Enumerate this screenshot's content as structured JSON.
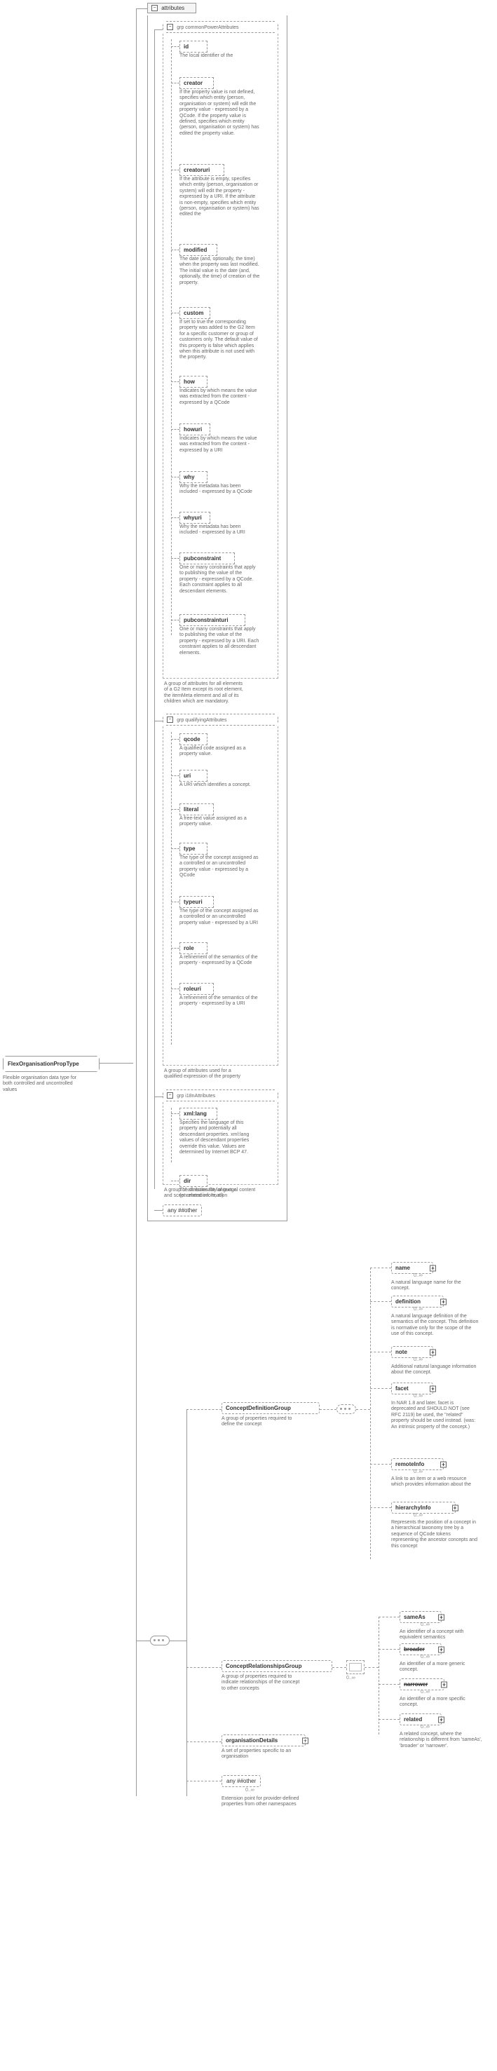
{
  "root": {
    "name": "FlexOrganisationPropType",
    "desc": "Flexible organisation data type for both controlled and uncontrolled values"
  },
  "attributesHeader": "attributes",
  "groups": {
    "common": {
      "label": "grp commonPowerAttributes",
      "desc": "A group of attributes for all elements of a G2 Item except its root element, the itemMeta element and all of its children which are mandatory."
    },
    "qualifying": {
      "label": "grp qualifyingAttributes",
      "desc": "A group of attributes used for a qualified expression of the property"
    },
    "i18n": {
      "label": "grp i18nAttributes",
      "desc": "A group of attributes for language and script related information"
    }
  },
  "commonAttrs": [
    {
      "name": "id",
      "desc": "The local identifier of the"
    },
    {
      "name": "creator",
      "desc": "If the property value is not defined, specifies which entity (person, organisation or system) will edit the property value - expressed by a QCode. If the property value is defined, specifies which entity (person, organisation or system) has edited the property value."
    },
    {
      "name": "creatoruri",
      "desc": "If the attribute is empty, specifies which entity (person, organisation or system) will edit the property - expressed by a URI. If the attribute is non-empty, specifies which entity (person, organisation or system) has edited the"
    },
    {
      "name": "modified",
      "desc": "The date (and, optionally, the time) when the property was last modified. The initial value is the date (and, optionally, the time) of creation of the property."
    },
    {
      "name": "custom",
      "desc": "If set to true the corresponding property was added to the G2 Item for a specific customer or group of customers only. The default value of this property is false which applies when this attribute is not used with the property."
    },
    {
      "name": "how",
      "desc": "Indicates by which means the value was extracted from the content - expressed by a QCode"
    },
    {
      "name": "howuri",
      "desc": "Indicates by which means the value was extracted from the content - expressed by a URI"
    },
    {
      "name": "why",
      "desc": "Why the metadata has been included - expressed by a QCode"
    },
    {
      "name": "whyuri",
      "desc": "Why the metadata has been included - expressed by a URI"
    },
    {
      "name": "pubconstraint",
      "desc": "One or many constraints that apply to publishing the value of the property - expressed by a QCode. Each constraint applies to all descendant elements."
    },
    {
      "name": "pubconstrainturi",
      "desc": "One or many constraints that apply to publishing the value of the property - expressed by a URI. Each constraint applies to all descendant elements."
    }
  ],
  "qualifyingAttrs": [
    {
      "name": "qcode",
      "desc": "A qualified code assigned as a property value."
    },
    {
      "name": "uri",
      "desc": "A URI which identifies a concept."
    },
    {
      "name": "literal",
      "desc": "A free-text value assigned as a property value."
    },
    {
      "name": "type",
      "desc": "The type of the concept assigned as a controlled or an uncontrolled property value - expressed by a QCode"
    },
    {
      "name": "typeuri",
      "desc": "The type of the concept assigned as a controlled or an uncontrolled property value - expressed by a URI"
    },
    {
      "name": "role",
      "desc": "A refinement of the semantics of the property - expressed by a QCode"
    },
    {
      "name": "roleuri",
      "desc": "A refinement of the semantics of the property - expressed by a URI"
    }
  ],
  "i18nAttrs": [
    {
      "name": "xml:lang",
      "desc": "Specifies the language of this property and potentially all descendant properties. xml:lang values of descendant properties override this value. Values are determined by Internet BCP 47."
    },
    {
      "name": "dir",
      "desc": "The directionality of textual content (enumeration: ltr, rtl)"
    }
  ],
  "anyOther": "any ##other",
  "anyOtherExt": "any ##other",
  "anyOtherDesc": "Extension point for provider-defined properties from other namespaces",
  "cdg": {
    "name": "ConceptDefinitionGroup",
    "desc": "A group of properties required to define the concept"
  },
  "crg": {
    "name": "ConceptRelationshipsGroup",
    "desc": "A group of properties required to indicate relationships of the concept to other concepts"
  },
  "orgDetails": {
    "name": "organisationDetails",
    "desc": "A set of properties specific to an organisation"
  },
  "cdgChildren": [
    {
      "name": "name",
      "desc": "A natural language name for the concept."
    },
    {
      "name": "definition",
      "desc": "A natural language definition of the semantics of the concept. This definition is normative only for the scope of the use of this concept."
    },
    {
      "name": "note",
      "desc": "Additional natural language information about the concept."
    },
    {
      "name": "facet",
      "desc": "In NAR 1.8 and later, facet is deprecated and SHOULD NOT (see RFC 2119) be used, the \"related\" property should be used instead. (was: An intrinsic property of the concept.)"
    },
    {
      "name": "remoteInfo",
      "desc": "A link to an item or a web resource which provides information about the"
    },
    {
      "name": "hierarchyInfo",
      "desc": "Represents the position of a concept in a hierarchical taxonomy tree by a sequence of QCode tokens representing the ancestor concepts and this concept"
    }
  ],
  "crgChildren": [
    {
      "name": "sameAs",
      "desc": "An identifier of a concept with equivalent semantics"
    },
    {
      "name": "broader",
      "desc": "An identifier of a more generic concept.",
      "struck": true
    },
    {
      "name": "narrower",
      "desc": "An identifier of a more specific concept.",
      "struck": true
    },
    {
      "name": "related",
      "desc": "A related concept, where the relationship is different from 'sameAs', 'broader' or 'narrower'."
    }
  ],
  "occ": "0..∞"
}
